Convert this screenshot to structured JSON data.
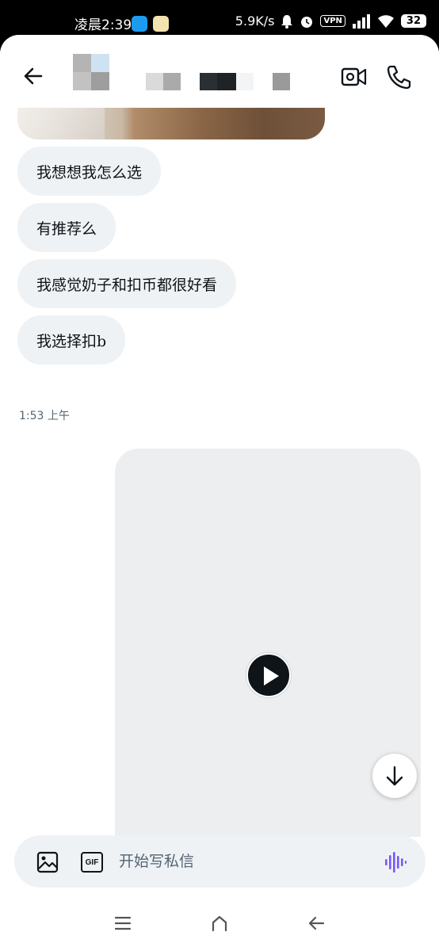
{
  "status_bar": {
    "time": "凌晨2:39",
    "net_speed": "5.9K/s",
    "vpn": "VPN",
    "battery": "32"
  },
  "icons": {
    "back": "arrow-left-icon",
    "video_call": "video-camera-icon",
    "phone": "phone-icon",
    "play": "play-icon",
    "scroll_down": "arrow-down-icon",
    "image": "image-icon",
    "gif": "gif-icon",
    "voice": "voice-waveform-icon",
    "nav_menu": "menu-icon",
    "nav_home": "home-icon",
    "nav_back": "back-icon"
  },
  "messages": [
    {
      "text": "我想想我怎么选"
    },
    {
      "text": "有推荐么"
    },
    {
      "text": "我感觉奶子和扣币都很好看"
    },
    {
      "text": "我选择扣b"
    }
  ],
  "timestamp": "1:53 上午",
  "compose": {
    "placeholder": "开始写私信",
    "gif_label": "GIF"
  },
  "colors": {
    "bubble_bg": "#eff2f5",
    "text": "#0f1419",
    "muted": "#536471",
    "accent": "#7856ff"
  }
}
